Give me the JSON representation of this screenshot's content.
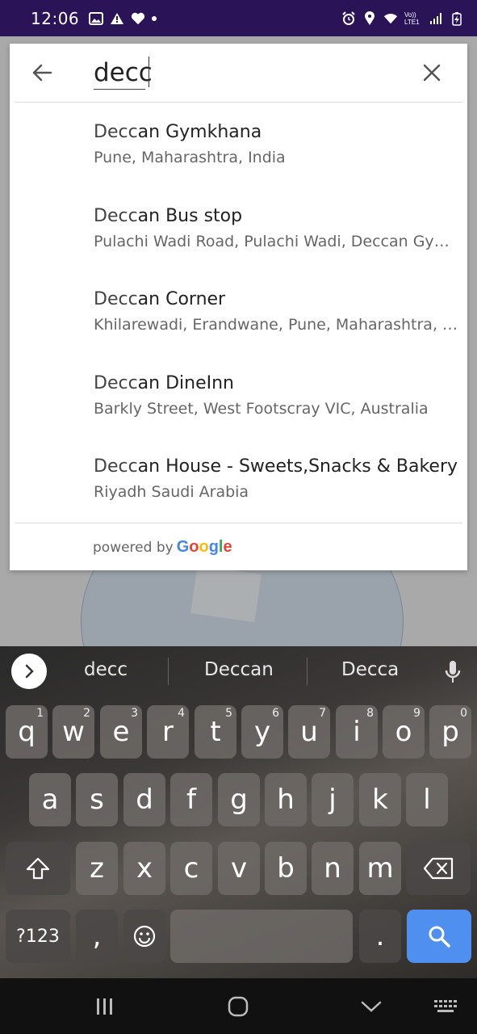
{
  "status_bar": {
    "time": "12:06",
    "network_label": "Vo)) LTE1"
  },
  "search": {
    "query": "decc",
    "back_icon": "arrow-left-icon",
    "clear_icon": "close-icon"
  },
  "results": [
    {
      "match": "Decc",
      "rest": "an Gymkhana",
      "subtitle": "Pune, Maharashtra, India"
    },
    {
      "match": "Decc",
      "rest": "an Bus stop",
      "subtitle": "Pulachi Wadi Road, Pulachi Wadi, Deccan Gym…"
    },
    {
      "match": "Decc",
      "rest": "an Corner",
      "subtitle": "Khilarewadi, Erandwane, Pune, Maharashtra, I…"
    },
    {
      "match": "Decc",
      "rest": "an DineInn",
      "subtitle": "Barkly Street, West Footscray VIC, Australia"
    },
    {
      "match": "Decc",
      "rest": "an House - Sweets,Snacks & Bakery",
      "subtitle": "Riyadh Saudi Arabia"
    }
  ],
  "attribution": {
    "powered_by": "powered by",
    "brand": "Google"
  },
  "keyboard": {
    "suggestions": [
      "decc",
      "Deccan",
      "Decca"
    ],
    "row1": [
      {
        "key": "q",
        "num": "1"
      },
      {
        "key": "w",
        "num": "2"
      },
      {
        "key": "e",
        "num": "3"
      },
      {
        "key": "r",
        "num": "4"
      },
      {
        "key": "t",
        "num": "5"
      },
      {
        "key": "y",
        "num": "6"
      },
      {
        "key": "u",
        "num": "7"
      },
      {
        "key": "i",
        "num": "8"
      },
      {
        "key": "o",
        "num": "9"
      },
      {
        "key": "p",
        "num": "0"
      }
    ],
    "row2": [
      "a",
      "s",
      "d",
      "f",
      "g",
      "h",
      "j",
      "k",
      "l"
    ],
    "row3": [
      "z",
      "x",
      "c",
      "v",
      "b",
      "n",
      "m"
    ],
    "symbols_label": "?123",
    "comma_label": ",",
    "period_label": "."
  },
  "colors": {
    "status_bar": "#2a1457",
    "search_key": "#4f8ff0",
    "google_blue": "#4285F4",
    "google_red": "#EA4335",
    "google_yellow": "#FBBC05",
    "google_green": "#34A853"
  }
}
